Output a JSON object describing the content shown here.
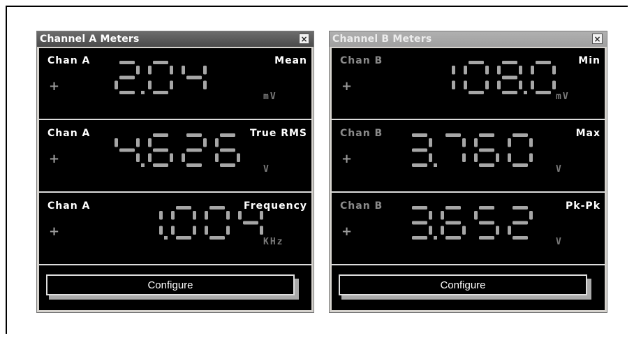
{
  "windows": [
    {
      "title": "Channel A Meters",
      "close_label": "×",
      "configure_label": "Configure",
      "meters": [
        {
          "channel": "Chan A",
          "measurement": "Mean",
          "sign": "+",
          "value": "2.04",
          "unit": "mV"
        },
        {
          "channel": "Chan A",
          "measurement": "True RMS",
          "sign": "+",
          "value": "4.626",
          "unit": "V"
        },
        {
          "channel": "Chan A",
          "measurement": "Frequency",
          "sign": "+",
          "value": "1.004",
          "unit": "KHz"
        }
      ]
    },
    {
      "title": "Channel B Meters",
      "close_label": "×",
      "configure_label": "Configure",
      "meters": [
        {
          "channel": "Chan B",
          "measurement": "Min",
          "sign": "+",
          "value": "108.0",
          "unit": "mV"
        },
        {
          "channel": "Chan B",
          "measurement": "Max",
          "sign": "+",
          "value": "3.760",
          "unit": "V"
        },
        {
          "channel": "Chan B",
          "measurement": "Pk-Pk",
          "sign": "+",
          "value": "3.652",
          "unit": "V"
        }
      ]
    }
  ],
  "colors": {
    "display_bg": "#000000",
    "segment": "#a6a6a6",
    "label": "#ffffff",
    "dim_label": "#8a8a8a"
  }
}
